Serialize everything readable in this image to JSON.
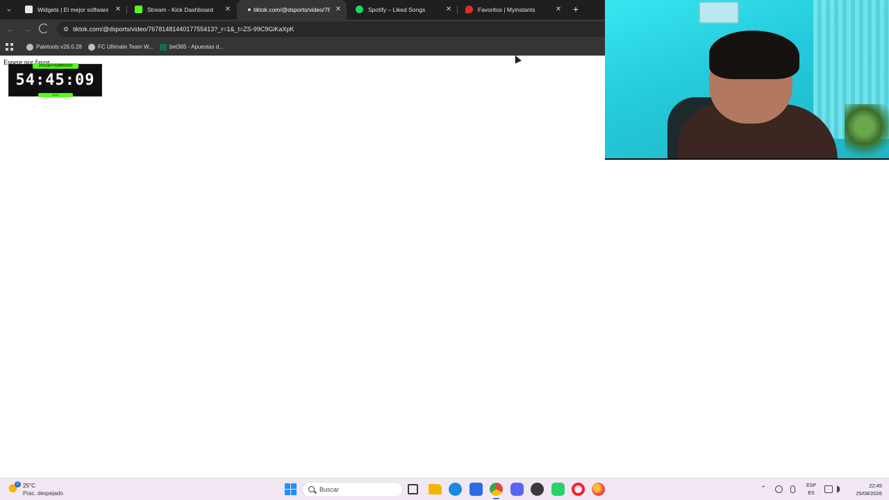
{
  "browser": {
    "tabs": [
      {
        "title": "Widgets | El mejor software pa",
        "favicon_color": "#e8e8e8",
        "active": false
      },
      {
        "title": "Stream - Kick Dashboard",
        "favicon_color": "#53fc18",
        "active": false
      },
      {
        "title": "tiktok.com/@dsports/video/76",
        "favicon_color": "#cfcfcf",
        "active": true
      },
      {
        "title": "Spotify – Liked Songs",
        "favicon_color": "#1ed760",
        "active": false
      },
      {
        "title": "Favoritos | Myinstants",
        "favicon_color": "#d93025",
        "active": false
      }
    ],
    "close_glyph": "✕",
    "new_tab_glyph": "+",
    "tab_search_glyph": "⌄",
    "back_glyph": "←",
    "forward_glyph": "→",
    "site_info_glyph": "⚙",
    "url": "tiktok.com/@dsports/video/7678148144017755413?_r=1&_t=ZS-99C9GiKaXpK",
    "bookmarks": [
      {
        "label": "Paletools v26.0.28",
        "icon_color": "#bdbdbd"
      },
      {
        "label": "FC Ultimate Team W...",
        "icon_color": "#bdbdbd"
      },
      {
        "label": "bet365 - Apuestas d...",
        "icon_color": "#126e51"
      }
    ]
  },
  "page": {
    "loading_text": "Espere por favor..."
  },
  "timer_widget": {
    "user": "JOSSEHYAMBRANO",
    "value": "54:45:09",
    "brand": "KICK",
    "accent_color": "#53fc18"
  },
  "taskbar": {
    "weather": {
      "temp": "25°C",
      "condition": "Prac. despejado",
      "badge": "2"
    },
    "search_placeholder": "Buscar",
    "apps": [
      {
        "name": "task-view",
        "color": "#3a3a3a"
      },
      {
        "name": "file-explorer",
        "color": "#f2b600"
      },
      {
        "name": "edge",
        "color": "#1b8adb"
      },
      {
        "name": "microsoft-store",
        "color": "#2d6cdf"
      },
      {
        "name": "chrome",
        "color": "#e8453c"
      },
      {
        "name": "discord",
        "color": "#5865f2"
      },
      {
        "name": "obs",
        "color": "#3a3a3a"
      },
      {
        "name": "whatsapp",
        "color": "#25d366"
      },
      {
        "name": "opera",
        "color": "#ff1b2d"
      },
      {
        "name": "firefox",
        "color": "#ff7139"
      }
    ],
    "language": {
      "primary": "ESP",
      "secondary": "ES"
    },
    "clock": {
      "time": "22:45",
      "date": "25/08/2026"
    }
  }
}
